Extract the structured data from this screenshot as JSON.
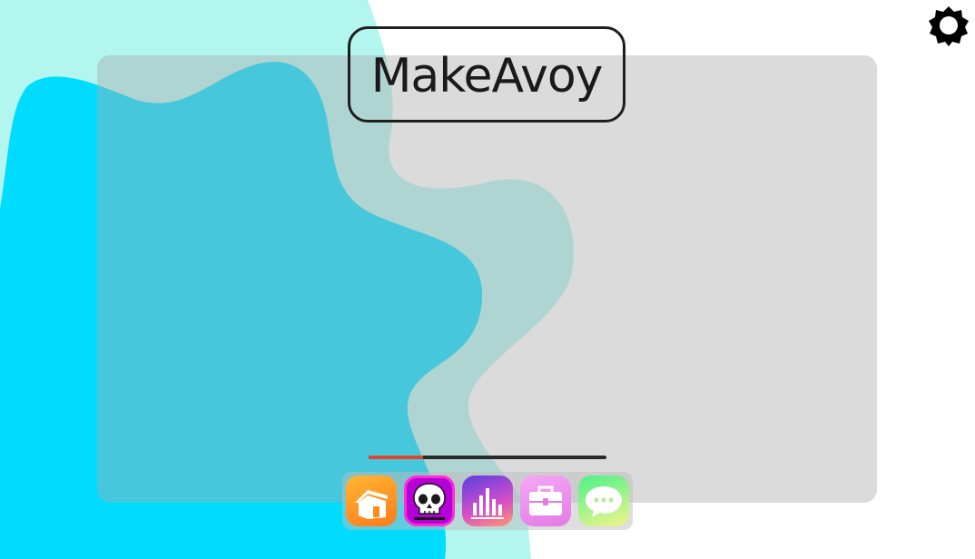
{
  "app": {
    "logo_text": "MakeAvoy"
  },
  "colors": {
    "blob_light": "#b3f5ef",
    "blob_dark": "#00dcff",
    "panel": "#d0d0d0",
    "progress_fill": "#e0452e"
  },
  "progress": {
    "fraction": 0.23
  },
  "header": {
    "settings_icon": "gear-icon"
  },
  "dock": {
    "apps": [
      {
        "icon": "home-icon"
      },
      {
        "icon": "skull-icon"
      },
      {
        "icon": "bar-chart-icon"
      },
      {
        "icon": "briefcase-icon"
      },
      {
        "icon": "chat-bubble-icon"
      }
    ]
  }
}
